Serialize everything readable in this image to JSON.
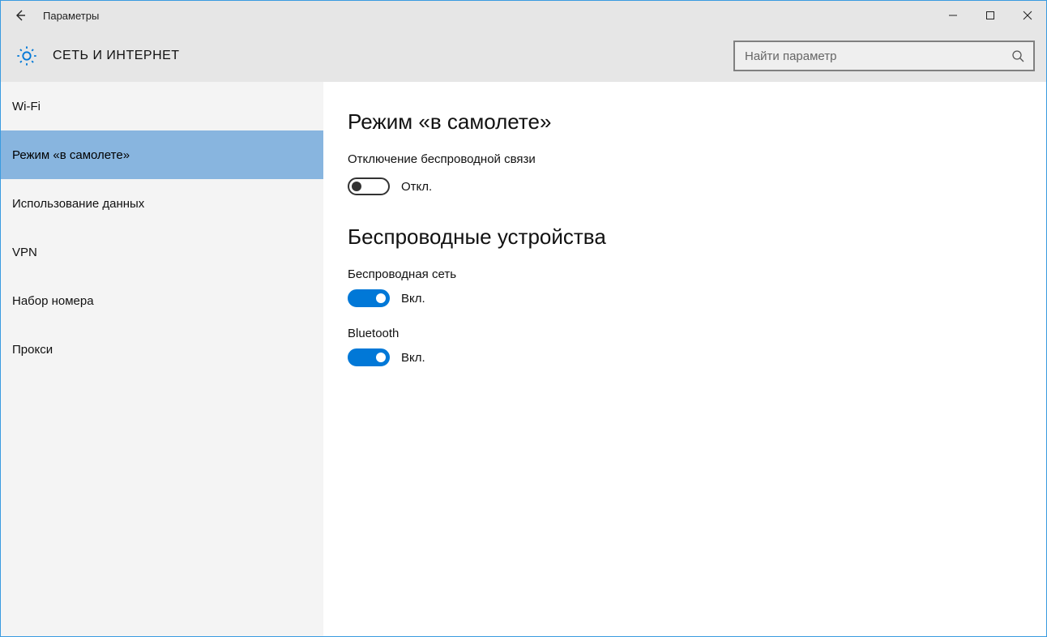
{
  "titlebar": {
    "title": "Параметры"
  },
  "header": {
    "heading": "СЕТЬ И ИНТЕРНЕТ",
    "search_placeholder": "Найти параметр"
  },
  "sidebar": {
    "items": [
      {
        "label": "Wi-Fi",
        "active": false
      },
      {
        "label": "Режим «в самолете»",
        "active": true
      },
      {
        "label": "Использование данных",
        "active": false
      },
      {
        "label": "VPN",
        "active": false
      },
      {
        "label": "Набор номера",
        "active": false
      },
      {
        "label": "Прокси",
        "active": false
      }
    ]
  },
  "main": {
    "section1": {
      "title": "Режим «в самолете»",
      "subtitle": "Отключение беспроводной связи",
      "toggle_state": "off",
      "toggle_label": "Откл."
    },
    "section2": {
      "title": "Беспроводные устройства",
      "devices": [
        {
          "name": "Беспроводная сеть",
          "state": "on",
          "label": "Вкл."
        },
        {
          "name": "Bluetooth",
          "state": "on",
          "label": "Вкл."
        }
      ]
    }
  }
}
